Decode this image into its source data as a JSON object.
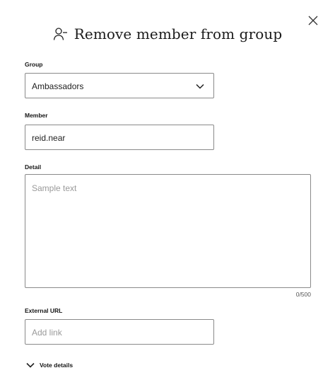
{
  "dialog": {
    "title": "Remove member from group",
    "title_icon": "user-minus-icon",
    "close_icon": "close-icon"
  },
  "form": {
    "group": {
      "label": "Group",
      "selected": "Ambassadors"
    },
    "member": {
      "label": "Member",
      "value": "reid.near"
    },
    "detail": {
      "label": "Detail",
      "placeholder": "Sample text",
      "counter": "0/500"
    },
    "external_url": {
      "label": "External URL",
      "placeholder": "Add link"
    },
    "vote_details": {
      "label": "Vote details"
    }
  }
}
